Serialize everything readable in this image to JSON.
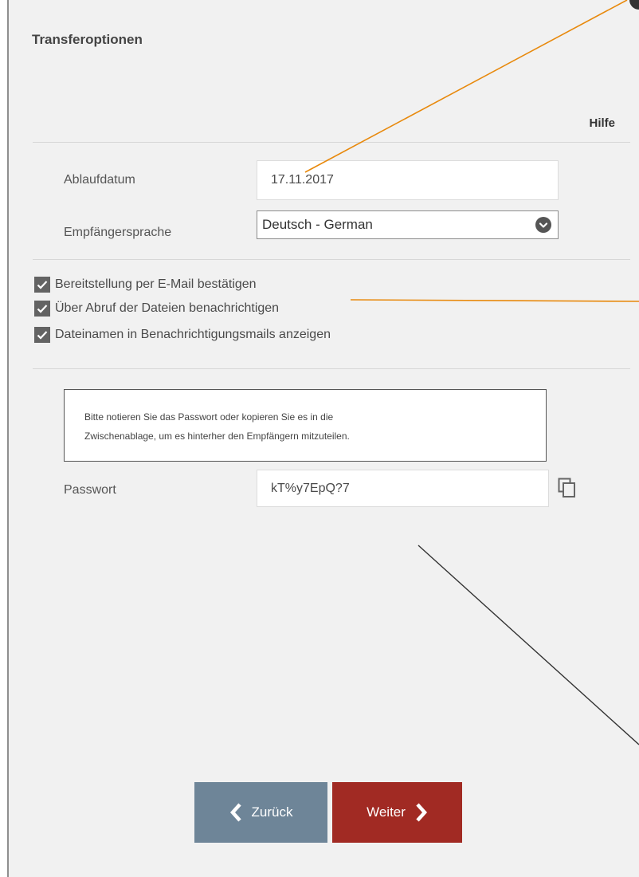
{
  "dialog": {
    "title": "Transferoptionen",
    "help_label": "Hilfe"
  },
  "form": {
    "expiry_label": "Ablaufdatum",
    "expiry_value": "17.11.2017",
    "language_label": "Empfängersprache",
    "language_value": "Deutsch - German"
  },
  "options": [
    {
      "label": "Bereitstellung per E-Mail bestätigen",
      "checked": true
    },
    {
      "label": "Über Abruf der Dateien benachrichtigen",
      "checked": true
    },
    {
      "label": "Dateinamen in Benachrichtigungsmails anzeigen",
      "checked": true
    }
  ],
  "password": {
    "notice_line1": "Bitte notieren Sie das Passwort oder kopieren Sie es in die",
    "notice_line2": "Zwischenablage, um es hinterher den Empfängern mitzuteilen.",
    "label": "Passwort",
    "value": "kT%y7EpQ?7",
    "copy_icon": "copy-icon"
  },
  "buttons": {
    "back_label": "Zurück",
    "next_label": "Weiter"
  },
  "colors": {
    "back_button": "#6e8598",
    "next_button": "#a12a23",
    "annotation_orange": "#e8890c",
    "annotation_dark": "#333333"
  }
}
